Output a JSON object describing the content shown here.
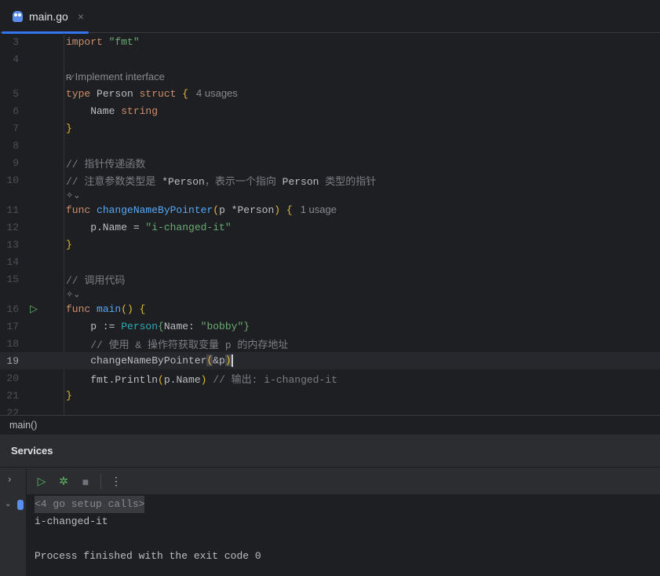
{
  "tab": {
    "filename": "main.go",
    "close": "×"
  },
  "editor": {
    "lines": [
      {
        "n": "3",
        "tokens": [
          [
            "k",
            "import "
          ],
          [
            "s",
            "\"fmt\""
          ]
        ]
      },
      {
        "n": "4",
        "tokens": []
      },
      {
        "hint": "Implement interface"
      },
      {
        "n": "5",
        "tokens": [
          [
            "k",
            "type "
          ],
          [
            "t",
            "Person "
          ],
          [
            "k",
            "struct "
          ],
          [
            "b",
            "{"
          ]
        ],
        "inlay": "4 usages"
      },
      {
        "n": "6",
        "tokens": [
          [
            "t",
            "    Name "
          ],
          [
            "k",
            "string"
          ]
        ]
      },
      {
        "n": "7",
        "tokens": [
          [
            "b",
            "}"
          ]
        ]
      },
      {
        "n": "8",
        "tokens": []
      },
      {
        "n": "9",
        "tokens": [
          [
            "c",
            "// 指针传递函数"
          ]
        ]
      },
      {
        "n": "10",
        "tokens": [
          [
            "c",
            "// 注意参数类型是 "
          ],
          [
            "t",
            "*Person"
          ],
          [
            "c",
            "，表示一个指向 "
          ],
          [
            "t",
            "Person"
          ],
          [
            "c",
            " 类型的指针"
          ]
        ]
      },
      {
        "icon": true
      },
      {
        "n": "11",
        "tokens": [
          [
            "k",
            "func "
          ],
          [
            "f",
            "changeNameByPointer"
          ],
          [
            "b",
            "("
          ],
          [
            "t",
            "p *Person"
          ],
          [
            "b",
            ")"
          ],
          [
            "t",
            " "
          ],
          [
            "b",
            "{"
          ]
        ],
        "inlay": "1 usage"
      },
      {
        "n": "12",
        "tokens": [
          [
            "t",
            "    p.Name = "
          ],
          [
            "s",
            "\"i-changed-it\""
          ]
        ]
      },
      {
        "n": "13",
        "tokens": [
          [
            "b",
            "}"
          ]
        ]
      },
      {
        "n": "14",
        "tokens": []
      },
      {
        "n": "15",
        "tokens": [
          [
            "c",
            "// 调用代码"
          ]
        ]
      },
      {
        "icon": true
      },
      {
        "n": "16",
        "run": true,
        "tokens": [
          [
            "k",
            "func "
          ],
          [
            "f",
            "main"
          ],
          [
            "b",
            "()"
          ],
          [
            "t",
            " "
          ],
          [
            "b",
            "{"
          ]
        ]
      },
      {
        "n": "17",
        "tokens": [
          [
            "t",
            "    p := "
          ],
          [
            "ty",
            "Person"
          ],
          [
            "s",
            "{"
          ],
          [
            "t",
            "Name: "
          ],
          [
            "s",
            "\"bobby\""
          ],
          [
            "s",
            "}"
          ]
        ]
      },
      {
        "n": "18",
        "tokens": [
          [
            "c",
            "    // 使用 & 操作符获取变量 p 的内存地址"
          ]
        ]
      },
      {
        "n": "19",
        "current": true,
        "tokens": [
          [
            "t",
            "    changeNameByPointer"
          ],
          [
            "bh",
            "("
          ],
          [
            "t",
            "&p"
          ],
          [
            "bh",
            ")"
          ]
        ]
      },
      {
        "n": "20",
        "tokens": [
          [
            "t",
            "    fmt.Println"
          ],
          [
            "b",
            "("
          ],
          [
            "t",
            "p.Name"
          ],
          [
            "b",
            ")"
          ],
          [
            "c",
            " // 输出: i-changed-it"
          ]
        ]
      },
      {
        "n": "21",
        "tokens": [
          [
            "b",
            "}"
          ]
        ]
      },
      {
        "n": "22",
        "tokens": []
      }
    ]
  },
  "breadcrumb": "main()",
  "services": {
    "title": "Services",
    "console": {
      "folded": "<4 go setup calls>",
      "output": "i-changed-it",
      "exit": "Process finished with the exit code 0"
    }
  }
}
